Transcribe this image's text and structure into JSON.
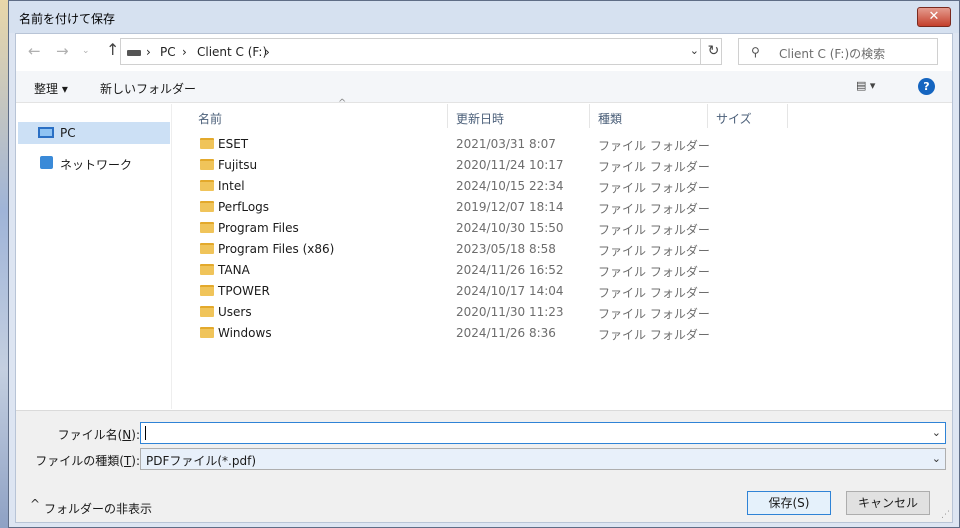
{
  "window": {
    "title": "名前を付けて保存",
    "close_label": "✕"
  },
  "navigation": {
    "breadcrumbs": [
      "PC",
      "Client C (F:)"
    ],
    "search_placeholder": "Client C (F:)の検索"
  },
  "toolbar": {
    "organize_label": "整理 ▾",
    "new_folder_label": "新しいフォルダー"
  },
  "nav_pane": {
    "items": [
      {
        "label": "PC"
      },
      {
        "label": "ネットワーク"
      }
    ]
  },
  "columns": {
    "name": "名前",
    "date": "更新日時",
    "type": "種類",
    "size": "サイズ"
  },
  "files": [
    {
      "name": "ESET",
      "date": "2021/03/31 8:07",
      "type": "ファイル フォルダー"
    },
    {
      "name": "Fujitsu",
      "date": "2020/11/24 10:17",
      "type": "ファイル フォルダー"
    },
    {
      "name": "Intel",
      "date": "2024/10/15 22:34",
      "type": "ファイル フォルダー"
    },
    {
      "name": "PerfLogs",
      "date": "2019/12/07 18:14",
      "type": "ファイル フォルダー"
    },
    {
      "name": "Program Files",
      "date": "2024/10/30 15:50",
      "type": "ファイル フォルダー"
    },
    {
      "name": "Program Files (x86)",
      "date": "2023/05/18 8:58",
      "type": "ファイル フォルダー"
    },
    {
      "name": "TANA",
      "date": "2024/11/26 16:52",
      "type": "ファイル フォルダー"
    },
    {
      "name": "TPOWER",
      "date": "2024/10/17 14:04",
      "type": "ファイル フォルダー"
    },
    {
      "name": "Users",
      "date": "2020/11/30 11:23",
      "type": "ファイル フォルダー"
    },
    {
      "name": "Windows",
      "date": "2024/11/26 8:36",
      "type": "ファイル フォルダー"
    }
  ],
  "form": {
    "filename_label_pre": "ファイル名(",
    "filename_label_key": "N",
    "filename_label_post": "):",
    "filename_value": "",
    "filetype_label_pre": "ファイルの種類(",
    "filetype_label_key": "T",
    "filetype_label_post": "):",
    "filetype_value": "PDFファイル(*.pdf)"
  },
  "footer": {
    "hide_folders_label": "フォルダーの非表示",
    "save_label": "保存(S)",
    "cancel_label": "キャンセル"
  }
}
